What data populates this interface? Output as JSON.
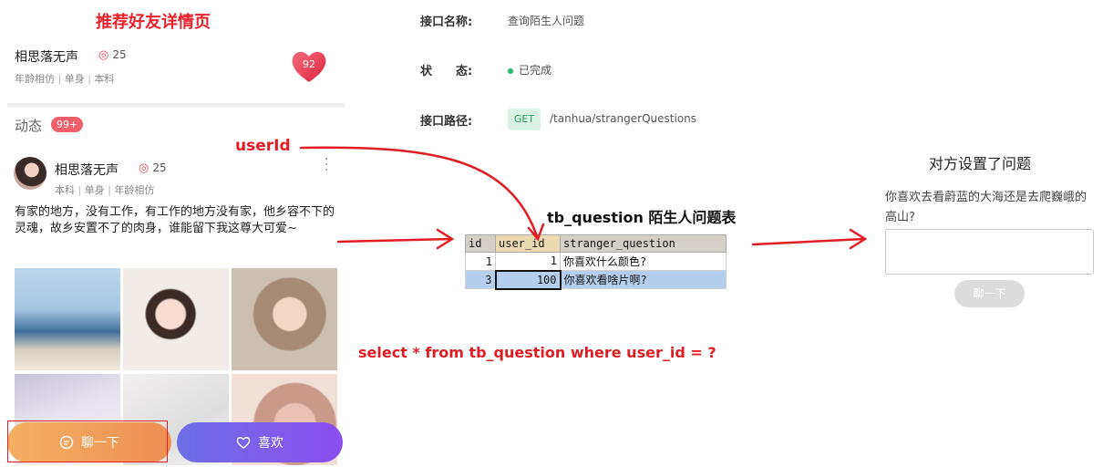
{
  "page_title": "推荐好友详情页",
  "profile": {
    "name": "相思落无声",
    "age": "25",
    "tags": [
      "年龄相仿",
      "单身",
      "本科"
    ],
    "score": "92"
  },
  "moments": {
    "label": "动态",
    "badge": "99+"
  },
  "post": {
    "author": "相思落无声",
    "age": "25",
    "tags": [
      "本科",
      "单身",
      "年龄相仿"
    ],
    "text": "有家的地方，没有工作，有工作的地方没有家，他乡容不下的灵魂，故乡安置不了的肉身，谁能留下我这尊大可爱~"
  },
  "actions": {
    "chat": "聊一下",
    "like": "喜欢"
  },
  "api": {
    "name_label": "接口名称:",
    "name_value": "查询陌生人问题",
    "status_label": "状　　态:",
    "status_value": "已完成",
    "path_label": "接口路径:",
    "method": "GET",
    "path": "/tanhua/strangerQuestions"
  },
  "annotations": {
    "userid": "userId",
    "table_title": "tb_question 陌生人问题表",
    "sql": "select * from tb_question where user_id = ?"
  },
  "table": {
    "columns": [
      "id",
      "user_id",
      "stranger_question"
    ],
    "rows": [
      [
        "1",
        "1",
        "你喜欢什么颜色?"
      ],
      [
        "3",
        "100",
        "你喜欢看啥片啊?"
      ]
    ]
  },
  "question_panel": {
    "title": "对方设置了问题",
    "question": "你喜欢去看蔚蓝的大海还是去爬巍峨的高山?",
    "button": "聊一下"
  },
  "colors": {
    "annotation_red": "#e11d24",
    "chat_gradient": [
      "#f3b062",
      "#ef8f53"
    ],
    "like_gradient": [
      "#6e6fe6",
      "#8c4df0"
    ],
    "status_green": "#25b864"
  }
}
